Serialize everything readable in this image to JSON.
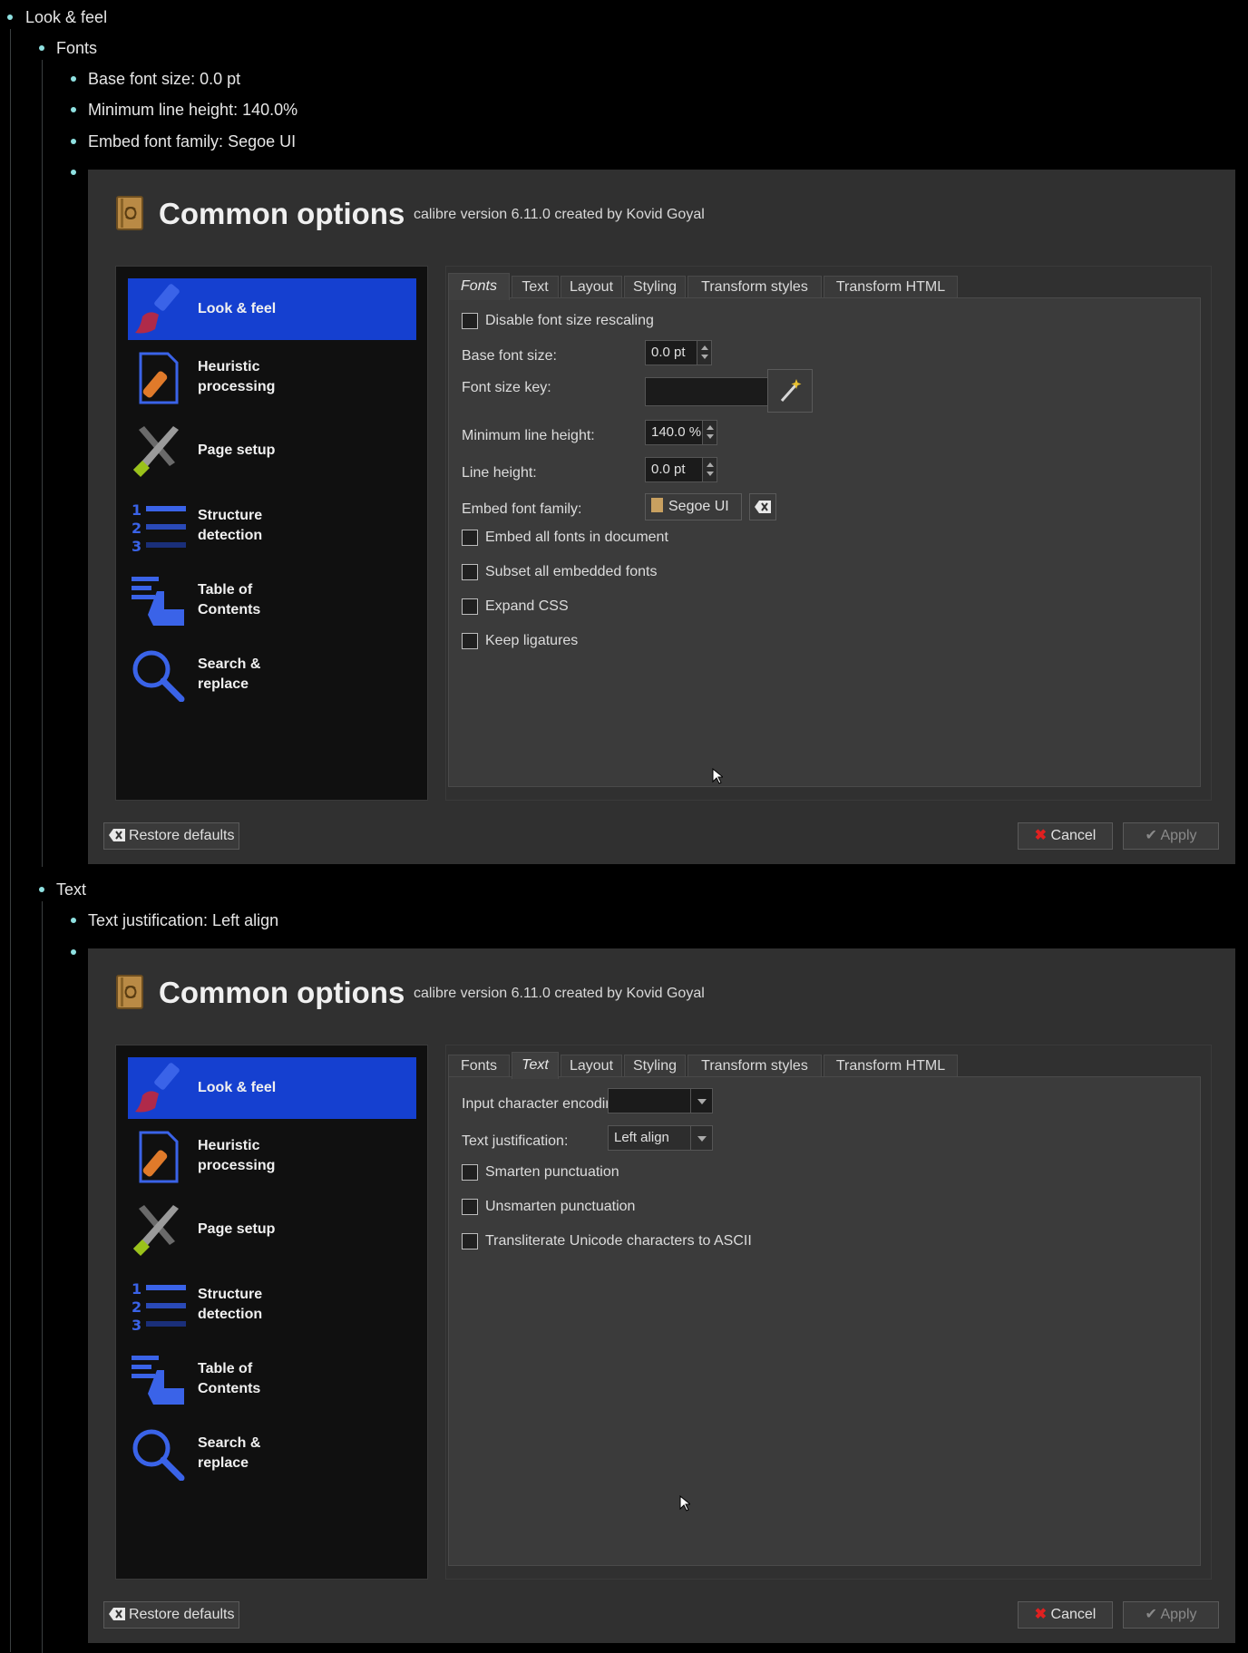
{
  "outline": {
    "look_feel": "Look & feel",
    "fonts": "Fonts",
    "base_font_size": "Base font size: 0.0 pt",
    "min_line_height": "Minimum line height: 140.0%",
    "embed_font_family": "Embed font family: Segoe UI",
    "text": "Text",
    "text_justification": "Text justification: Left align"
  },
  "dialog": {
    "title": "Common options",
    "subtitle": "calibre version 6.11.0 created by Kovid Goyal",
    "sidebar": [
      {
        "label": "Look & feel",
        "icon": "brush-icon"
      },
      {
        "label": "Heuristic\nprocessing",
        "icon": "document-bandage-icon"
      },
      {
        "label": "Page setup",
        "icon": "tools-icon"
      },
      {
        "label": "Structure\ndetection",
        "icon": "numbered-list-icon"
      },
      {
        "label": "Table of\nContents",
        "icon": "toc-hand-icon"
      },
      {
        "label": "Search &\nreplace",
        "icon": "magnifier-icon"
      }
    ],
    "tabs": [
      "Fonts",
      "Text",
      "Layout",
      "Styling",
      "Transform styles",
      "Transform HTML"
    ],
    "restore_defaults": "Restore defaults",
    "cancel": "Cancel",
    "apply": "Apply"
  },
  "fonts_tab": {
    "disable_rescaling": "Disable font size rescaling",
    "base_font_size_label": "Base font size:",
    "base_font_size_value": "0.0 pt",
    "font_size_key_label": "Font size key:",
    "font_size_key_value": "",
    "min_line_height_label": "Minimum line height:",
    "min_line_height_value": "140.0 %",
    "line_height_label": "Line height:",
    "line_height_value": "0.0 pt",
    "embed_family_label": "Embed font family:",
    "embed_family_value": "Segoe UI",
    "embed_all": "Embed all fonts in document",
    "subset_all": "Subset all embedded fonts",
    "expand_css": "Expand CSS",
    "keep_ligatures": "Keep ligatures"
  },
  "text_tab": {
    "input_encoding_label": "Input character encoding:",
    "input_encoding_value": "",
    "justification_label": "Text justification:",
    "justification_value": "Left align",
    "smarten": "Smarten punctuation",
    "unsmarten": "Unsmarten punctuation",
    "transliterate": "Transliterate Unicode characters to ASCII"
  },
  "colors": {
    "bullet": "#8fe1e1",
    "selection": "#1540d0",
    "cancel_x": "#e02020"
  }
}
